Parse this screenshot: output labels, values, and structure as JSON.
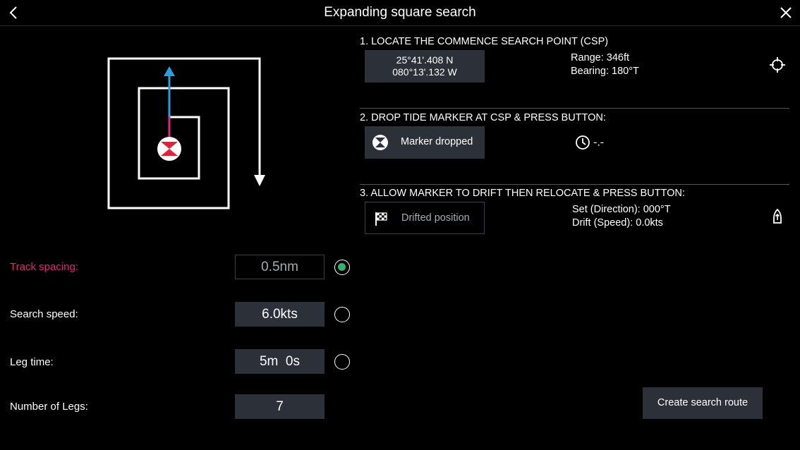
{
  "header": {
    "title": "Expanding square search",
    "back_icon": "back-chevron-icon",
    "close_icon": "close-icon"
  },
  "colors": {
    "background": "#000000",
    "box": "#2c3038",
    "active_label": "#e0287a",
    "radio_selected": "#2fb36e",
    "track_arrow": "#2a9fe0",
    "set_direction": "#4b8fe0"
  },
  "params": {
    "track_spacing": {
      "label": "Track spacing:",
      "value": "0.5nm",
      "selected": true
    },
    "search_speed": {
      "label": "Search speed:",
      "value": "6.0kts",
      "selected": false
    },
    "leg_time": {
      "label": "Leg time:",
      "value": "5m  0s",
      "selected": false
    },
    "number_of_legs": {
      "label": "Number of Legs:",
      "value": "7"
    }
  },
  "step1": {
    "title": "1. LOCATE THE COMMENCE SEARCH POINT (CSP)",
    "lat": "25°41'.408 N",
    "lon": "080°13'.132 W",
    "range": "Range: 346ft",
    "bearing": "Bearing: 180°T",
    "icon": "crosshair-target-icon"
  },
  "step2": {
    "title": "2. DROP TIDE MARKER AT CSP & PRESS BUTTON:",
    "button_label": "Marker dropped",
    "button_icon": "tide-marker-icon",
    "timer_icon": "clock-icon",
    "timer_value": "-.-"
  },
  "step3": {
    "title": "3. ALLOW MARKER TO DRIFT THEN RELOCATE & PRESS BUTTON:",
    "button_label": "Drifted position",
    "button_icon": "checkered-flag-icon",
    "set_direction": "Set (Direction): 000°T",
    "drift_speed": "Drift (Speed): 0.0kts",
    "icon": "vessel-icon"
  },
  "actions": {
    "create_route": "Create search route"
  }
}
